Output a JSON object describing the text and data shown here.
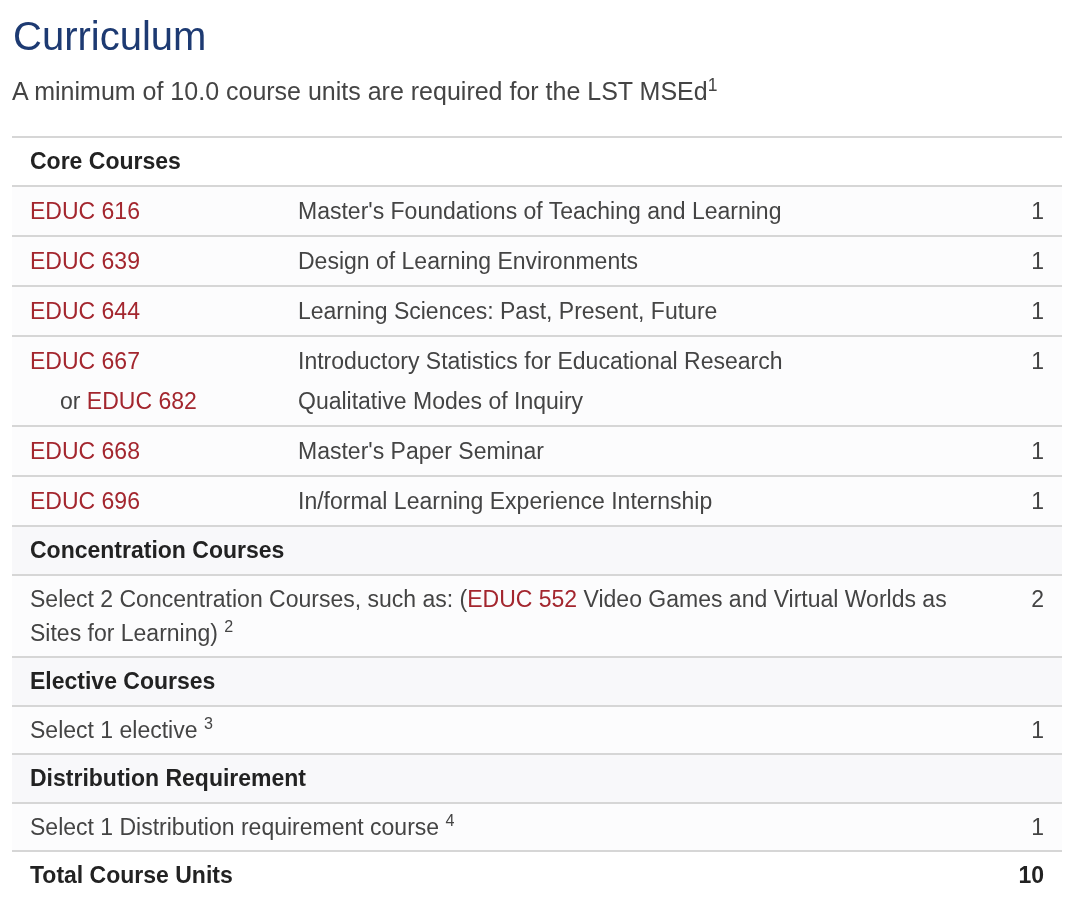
{
  "title": "Curriculum",
  "intro": "A minimum of 10.0 course units are required for the LST MSEd$^{1}$",
  "sections": [
    {
      "heading": "Core Courses",
      "rows": [
        {
          "kind": "course",
          "code": "EDUC 616",
          "name": "Master's Foundations of Teaching and Learning",
          "units": "1"
        },
        {
          "kind": "course",
          "code": "EDUC 639",
          "name": "Design of Learning Environments",
          "units": "1"
        },
        {
          "kind": "course",
          "code": "EDUC 644",
          "name": "Learning Sciences: Past, Present, Future",
          "units": "1"
        },
        {
          "kind": "alternative",
          "code": "EDUC 667",
          "name": "Introductory Statistics for Educational Research",
          "units": "1",
          "alt_prefix": "or",
          "alt_code": "EDUC 682",
          "alt_name": "Qualitative Modes of Inquiry"
        },
        {
          "kind": "course",
          "code": "EDUC 668",
          "name": "Master's Paper Seminar",
          "units": "1"
        },
        {
          "kind": "course",
          "code": "EDUC 696",
          "name": "In/formal Learning Experience Internship",
          "units": "1"
        }
      ]
    },
    {
      "heading": "Concentration Courses",
      "rows": [
        {
          "kind": "text",
          "before": "Select 2 Concentration Courses, such as: (",
          "link": "EDUC 552",
          "after": " Video Games and Virtual Worlds as Sites for Learning) $^{2}$",
          "units": "2"
        }
      ]
    },
    {
      "heading": "Elective Courses",
      "rows": [
        {
          "kind": "text",
          "before": "Select 1 elective $^{3}$",
          "units": "1"
        }
      ]
    },
    {
      "heading": "Distribution Requirement",
      "rows": [
        {
          "kind": "text",
          "before": "Select 1 Distribution requirement course $^{4}$",
          "units": "1"
        }
      ]
    }
  ],
  "total": {
    "label": "Total Course Units",
    "units": "10"
  }
}
